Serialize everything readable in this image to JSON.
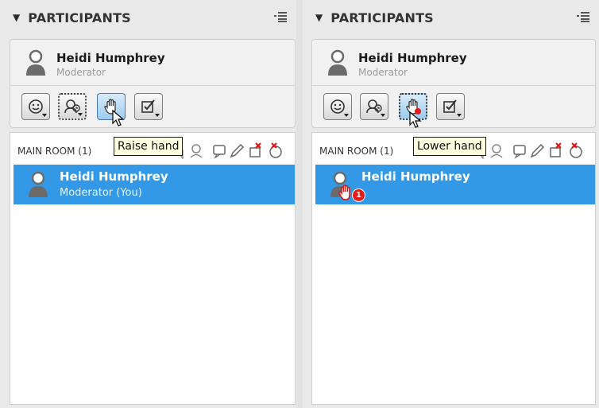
{
  "left_panel": {
    "header": {
      "title": "PARTICIPANTS",
      "caret_icon": "triangle-down-icon",
      "menu_icon": "list-menu-icon"
    },
    "me": {
      "name": "Heidi Humphrey",
      "role": "Moderator"
    },
    "toolbar": [
      {
        "icon": "emoticon-icon"
      },
      {
        "icon": "user-status-icon"
      },
      {
        "icon": "raise-hand-icon",
        "active": true
      },
      {
        "icon": "checkbox-icon"
      }
    ],
    "room": {
      "label": "MAIN ROOM (1)",
      "participants": [
        {
          "name": "Heidi Humphrey",
          "subtitle": "Moderator (You)"
        }
      ]
    },
    "tooltip": "Raise hand"
  },
  "right_panel": {
    "header": {
      "title": "PARTICIPANTS",
      "caret_icon": "triangle-down-icon",
      "menu_icon": "list-menu-icon"
    },
    "me": {
      "name": "Heidi Humphrey",
      "role": "Moderator"
    },
    "toolbar": [
      {
        "icon": "emoticon-icon"
      },
      {
        "icon": "user-status-icon"
      },
      {
        "icon": "raise-hand-icon",
        "active": true
      },
      {
        "icon": "checkbox-icon"
      }
    ],
    "room": {
      "label": "MAIN ROOM (1)",
      "participants": [
        {
          "name": "Heidi Humphrey",
          "badge_count": "1"
        }
      ]
    },
    "tooltip": "Lower hand"
  },
  "colors": {
    "selection": "#3399e6",
    "badge": "#e21b1b",
    "tooltip_bg": "#ffffe1"
  }
}
